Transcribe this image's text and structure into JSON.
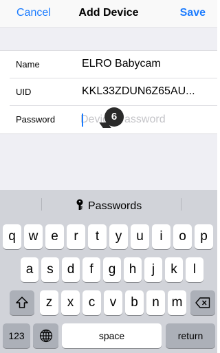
{
  "navbar": {
    "cancel_label": "Cancel",
    "title": "Add Device",
    "save_label": "Save"
  },
  "form": {
    "name_label": "Name",
    "name_value": "ELRO Babycam",
    "uid_label": "UID",
    "uid_value": "KKL33ZDUN6Z65AU...",
    "password_label": "Password",
    "password_placeholder": "Device Password"
  },
  "annotation": {
    "step_number": "6"
  },
  "keyboard": {
    "suggestion": "Passwords",
    "row1": [
      "q",
      "w",
      "e",
      "r",
      "t",
      "y",
      "u",
      "i",
      "o",
      "p"
    ],
    "row2": [
      "a",
      "s",
      "d",
      "f",
      "g",
      "h",
      "j",
      "k",
      "l"
    ],
    "row3": [
      "z",
      "x",
      "c",
      "v",
      "b",
      "n",
      "m"
    ],
    "numbers_label": "123",
    "space_label": "space",
    "return_label": "return"
  },
  "colors": {
    "accent": "#1a7bff",
    "grouped_background": "#efeff4",
    "keyboard_background": "#d1d3d9",
    "function_key": "#acb0b8"
  }
}
